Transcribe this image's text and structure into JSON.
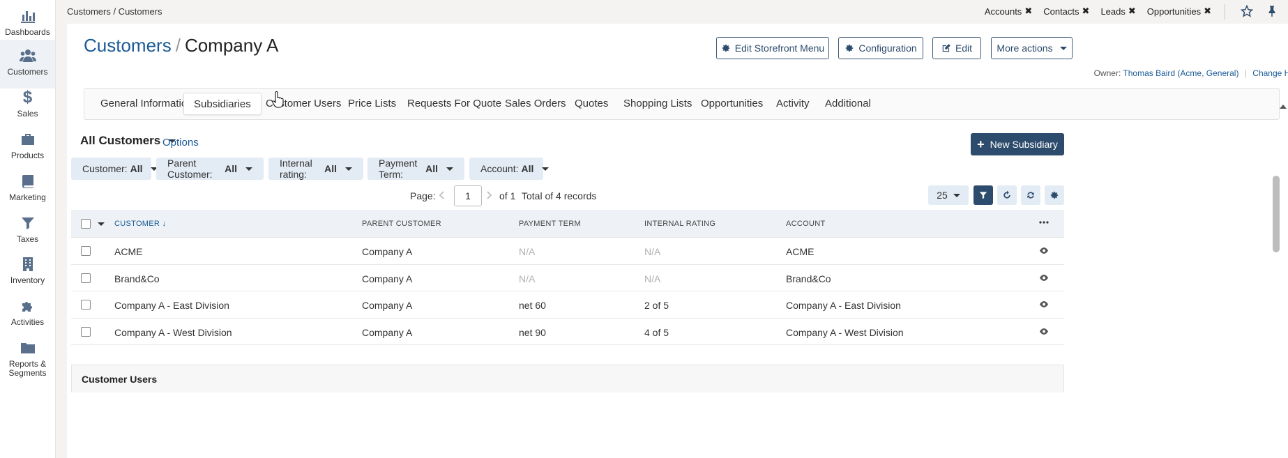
{
  "sidebar": {
    "items": [
      {
        "label": "Dashboards",
        "icon": "chart-bar-icon"
      },
      {
        "label": "Customers",
        "icon": "users-icon"
      },
      {
        "label": "Sales",
        "icon": "dollar-icon"
      },
      {
        "label": "Products",
        "icon": "briefcase-icon"
      },
      {
        "label": "Marketing",
        "icon": "book-icon"
      },
      {
        "label": "Taxes",
        "icon": "funnel-icon"
      },
      {
        "label": "Inventory",
        "icon": "building-icon"
      },
      {
        "label": "Activities",
        "icon": "puzzle-icon"
      },
      {
        "label": "Reports &\nSegments",
        "icon": "folder-icon"
      }
    ]
  },
  "topbar": {
    "breadcrumb": "Customers / Customers",
    "pins": [
      "Accounts",
      "Contacts",
      "Leads",
      "Opportunities"
    ]
  },
  "header": {
    "title_link": "Customers",
    "title_sep": "/",
    "title_name": "Company A",
    "actions": {
      "edit_storefront": "Edit Storefront Menu",
      "configuration": "Configuration",
      "edit": "Edit",
      "more_actions": "More actions"
    },
    "owner_label": "Owner:",
    "owner_value": "Thomas Baird (Acme, General)",
    "change_history": "Change History"
  },
  "tabs": [
    "General Information",
    "Subsidiaries",
    "Customer Users",
    "Price Lists",
    "Requests For Quote",
    "Sales Orders",
    "Quotes",
    "Shopping Lists",
    "Opportunities",
    "Activity",
    "Additional"
  ],
  "active_tab": "Subsidiaries",
  "grid": {
    "view_name": "All Customers",
    "options_label": "Options",
    "new_button": "New Subsidiary",
    "filters": [
      {
        "label": "Customer:",
        "value": "All"
      },
      {
        "label": "Parent Customer:",
        "value": "All"
      },
      {
        "label": "Internal rating:",
        "value": "All"
      },
      {
        "label": "Payment Term:",
        "value": "All"
      },
      {
        "label": "Account:",
        "value": "All"
      }
    ],
    "pager": {
      "page_label": "Page:",
      "page": "1",
      "of": "of 1",
      "total": "Total of 4 records"
    },
    "per_page": "25",
    "columns": [
      "CUSTOMER",
      "PARENT CUSTOMER",
      "PAYMENT TERM",
      "INTERNAL RATING",
      "ACCOUNT"
    ],
    "rows": [
      {
        "customer": "ACME",
        "parent": "Company A",
        "term": "N/A",
        "rating": "N/A",
        "account": "ACME"
      },
      {
        "customer": "Brand&Co",
        "parent": "Company A",
        "term": "N/A",
        "rating": "N/A",
        "account": "Brand&Co"
      },
      {
        "customer": "Company A - East Division",
        "parent": "Company A",
        "term": "net 60",
        "rating": "2 of 5",
        "account": "Company A - East Division"
      },
      {
        "customer": "Company A - West Division",
        "parent": "Company A",
        "term": "net 90",
        "rating": "4 of 5",
        "account": "Company A - West Division"
      }
    ]
  },
  "customer_users_section": {
    "title": "Customer Users"
  },
  "colors": {
    "accent": "#2d4b6c",
    "link": "#1a5a96",
    "filter_bg": "#e3ebf4"
  }
}
